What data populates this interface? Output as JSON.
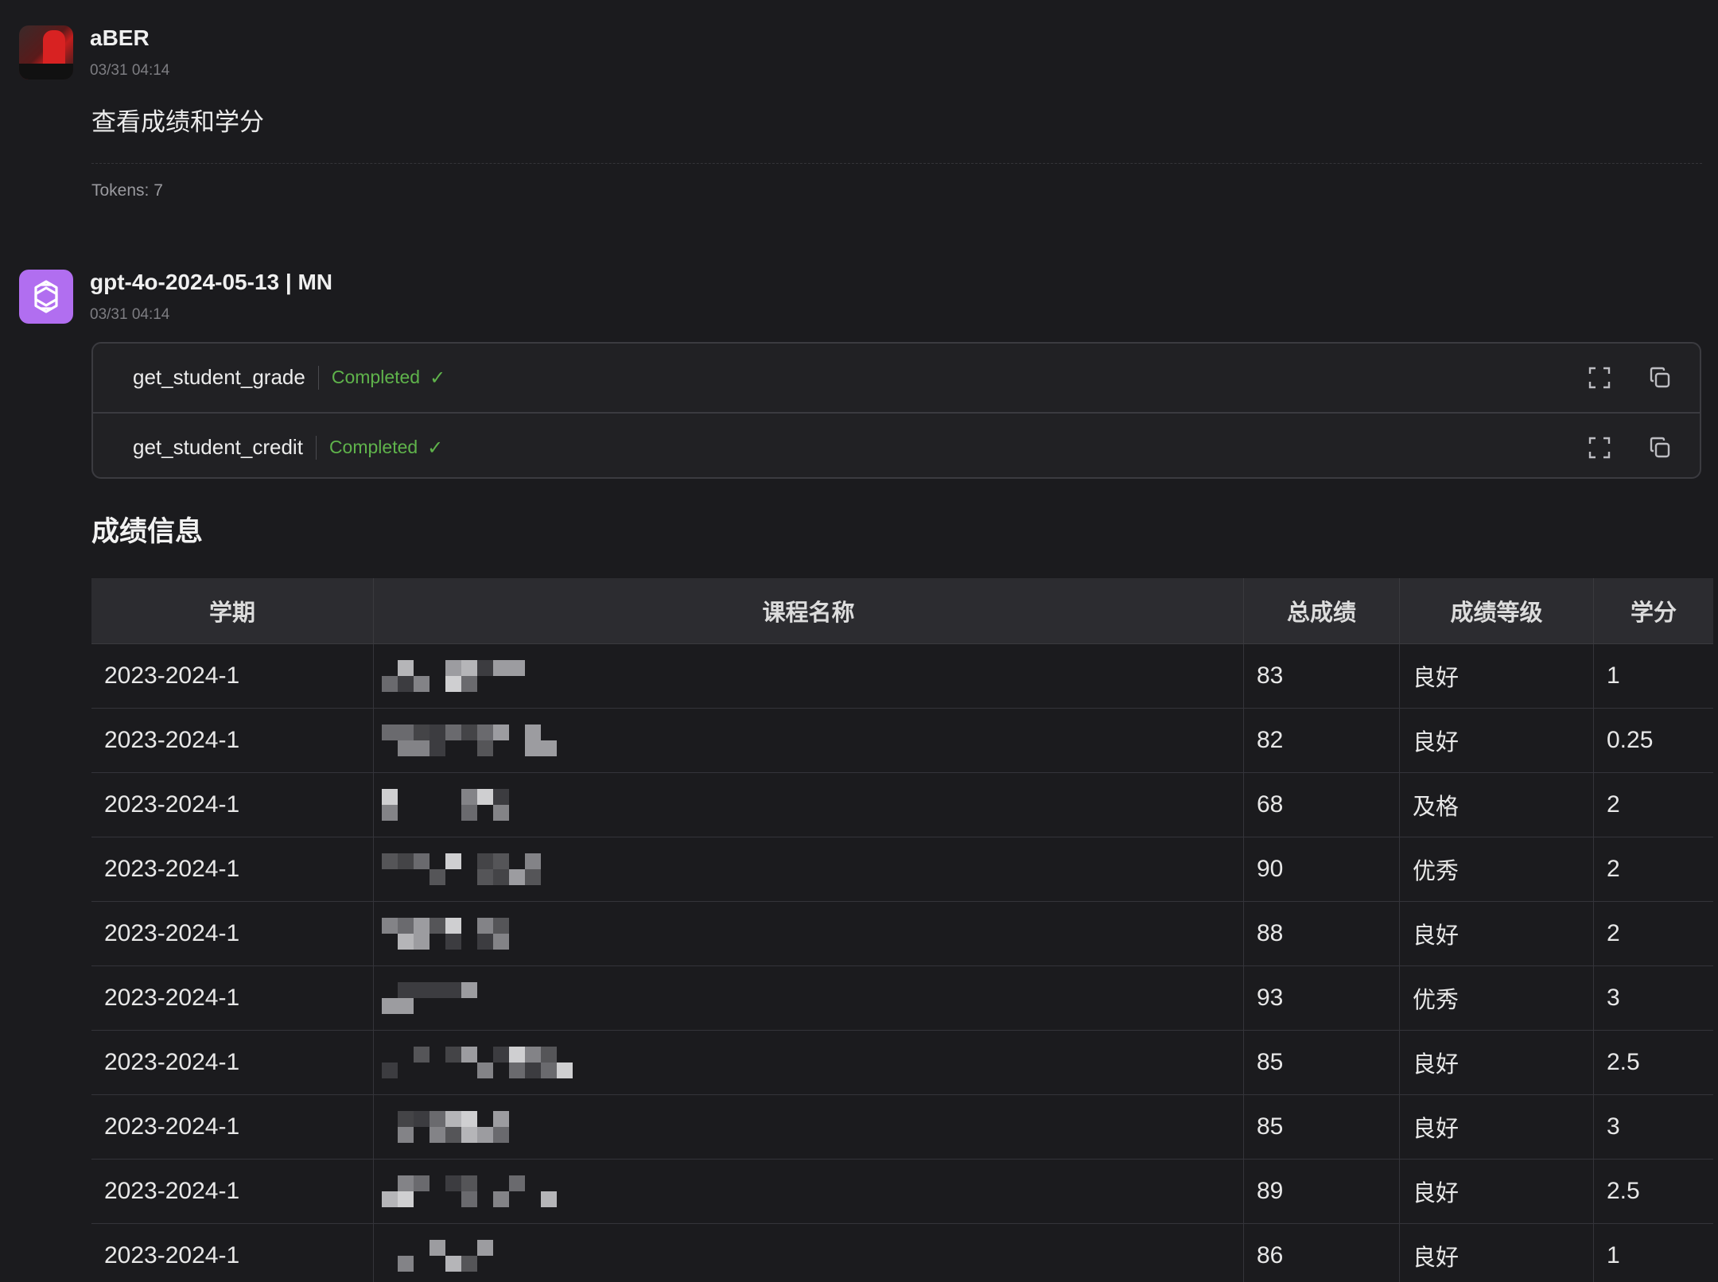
{
  "user_message": {
    "sender": "aBER",
    "timestamp": "03/31 04:14",
    "text": "查看成绩和学分",
    "tokens": "Tokens: 7"
  },
  "bot_message": {
    "sender": "gpt-4o-2024-05-13 | MN",
    "timestamp": "03/31 04:14",
    "tool_calls": [
      {
        "name": "get_student_grade",
        "status": "Completed"
      },
      {
        "name": "get_student_credit",
        "status": "Completed"
      }
    ],
    "section_title": "成绩信息",
    "table": {
      "headers": [
        "学期",
        "课程名称",
        "总成绩",
        "成绩等级",
        "学分"
      ],
      "rows": [
        {
          "term": "2023-2024-1",
          "total": "83",
          "level": "良好",
          "credit": "1"
        },
        {
          "term": "2023-2024-1",
          "total": "82",
          "level": "良好",
          "credit": "0.25"
        },
        {
          "term": "2023-2024-1",
          "total": "68",
          "level": "及格",
          "credit": "2"
        },
        {
          "term": "2023-2024-1",
          "total": "90",
          "level": "优秀",
          "credit": "2"
        },
        {
          "term": "2023-2024-1",
          "total": "88",
          "level": "良好",
          "credit": "2"
        },
        {
          "term": "2023-2024-1",
          "total": "93",
          "level": "优秀",
          "credit": "3"
        },
        {
          "term": "2023-2024-1",
          "total": "85",
          "level": "良好",
          "credit": "2.5"
        },
        {
          "term": "2023-2024-1",
          "total": "85",
          "level": "良好",
          "credit": "3"
        },
        {
          "term": "2023-2024-1",
          "total": "89",
          "level": "良好",
          "credit": "2.5"
        },
        {
          "term": "2023-2024-1",
          "total": "86",
          "level": "良好",
          "credit": "1"
        }
      ]
    }
  },
  "icons": {
    "user_avatar": "user-avatar-photo",
    "bot_avatar": "openai-logo-icon",
    "status": "check-icon",
    "expand": "expand-icon",
    "copy": "copy-icon"
  },
  "colors": {
    "background": "#1b1b1e",
    "status_green": "#5fb34b",
    "bot_avatar": "#b16ef0"
  }
}
